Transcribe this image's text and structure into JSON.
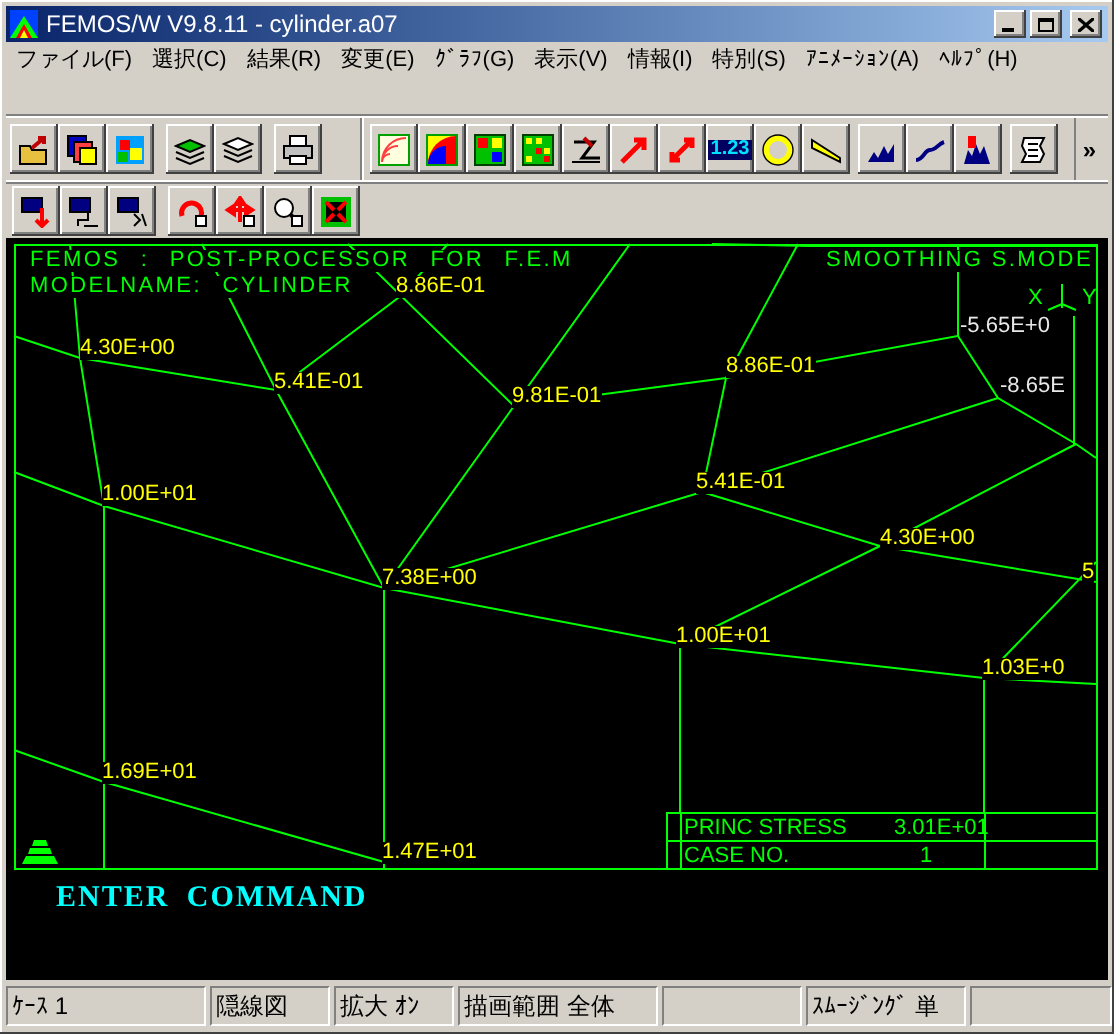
{
  "window": {
    "title": "FEMOS/W V9.8.11 - cylinder.a07"
  },
  "menu": [
    {
      "label": "ファイル(F)"
    },
    {
      "label": "選択(C)"
    },
    {
      "label": "結果(R)"
    },
    {
      "label": "変更(E)"
    },
    {
      "label": "ｸﾞﾗﾌ(G)"
    },
    {
      "label": "表示(V)"
    },
    {
      "label": "情報(I)"
    },
    {
      "label": "特別(S)"
    },
    {
      "label": "ｱﾆﾒｰｼｮﾝ(A)"
    },
    {
      "label": "ﾍﾙﾌﾟ(H)"
    }
  ],
  "toolbar": {
    "values_button": "1.23",
    "overflow": "»"
  },
  "viewport": {
    "header_left": [
      "FEMOS : POST-PROCESSOR FOR F.E.M",
      "MODELNAME: CYLINDER"
    ],
    "header_right": "SMOOTHING S.MODE",
    "axis_labels": [
      "X",
      "Y"
    ],
    "node_values": [
      {
        "text": "8.86E-01",
        "color": "#ffff00"
      },
      {
        "text": "4.30E+00",
        "color": "#ffff00"
      },
      {
        "text": "5.41E-01",
        "color": "#ffff00"
      },
      {
        "text": "9.81E-01",
        "color": "#ffff00"
      },
      {
        "text": "8.86E-01",
        "color": "#ffff00"
      },
      {
        "text": "-5.65E+0",
        "color": "#e8e8e8"
      },
      {
        "text": "-8.65E",
        "color": "#e8e8e8"
      },
      {
        "text": "1.00E+01",
        "color": "#ffff00"
      },
      {
        "text": "5.41E-01",
        "color": "#ffff00"
      },
      {
        "text": "4.30E+00",
        "color": "#ffff00"
      },
      {
        "text": "7.38E+00",
        "color": "#ffff00"
      },
      {
        "text": "5",
        "color": "#ffff00"
      },
      {
        "text": "1.00E+01",
        "color": "#ffff00"
      },
      {
        "text": "1.03E+0",
        "color": "#ffff00"
      },
      {
        "text": "1.69E+01",
        "color": "#ffff00"
      },
      {
        "text": "1.47E+01",
        "color": "#ffff00"
      }
    ],
    "legend": {
      "quantity": "PRINC STRESS",
      "value": "3.01E+01",
      "case_label": "CASE NO.",
      "case": "1"
    }
  },
  "command_prompt": "ENTER COMMAND",
  "status_bar": [
    "ｹｰｽ 1",
    "隠線図",
    "拡大 ｵﾝ",
    "描画範囲 全体",
    "ｽﾑｰｼﾞﾝｸﾞ 単"
  ]
}
